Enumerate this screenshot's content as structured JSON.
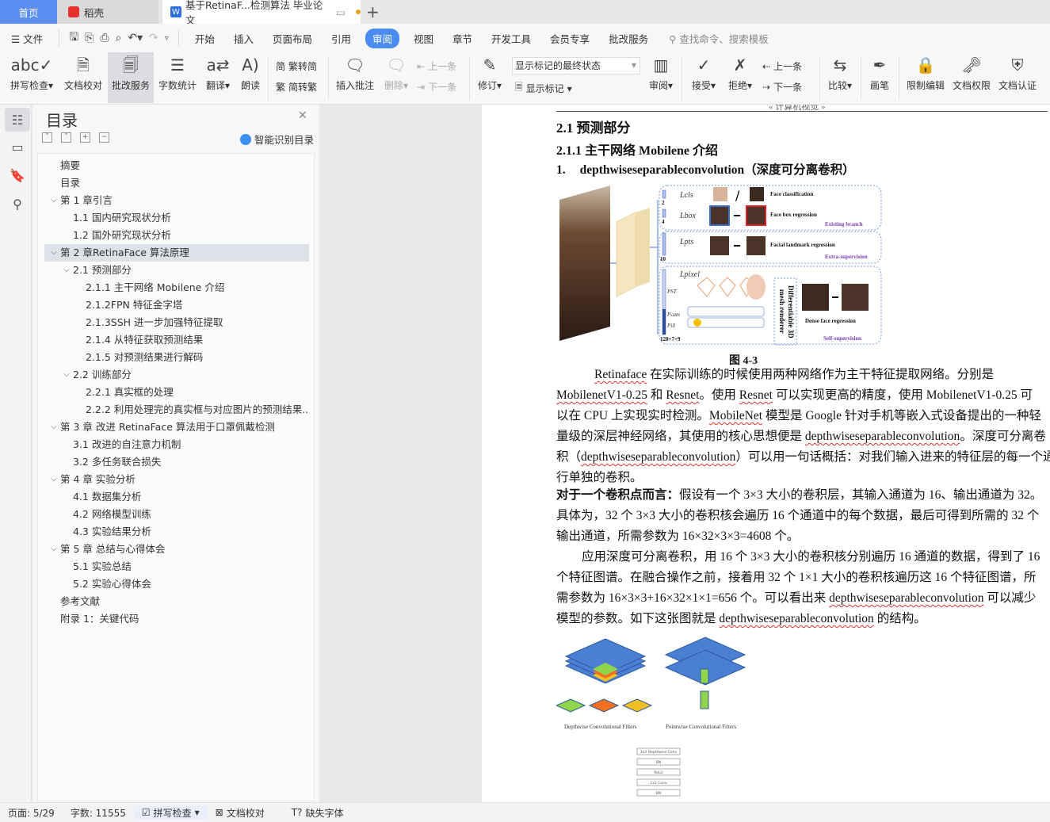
{
  "tabs": {
    "home": "首页",
    "docer": "稻壳",
    "doc": "基于RetinaF...检测算法 毕业论文",
    "add": "+"
  },
  "menu": {
    "file": "文件",
    "items": [
      "开始",
      "插入",
      "页面布局",
      "引用",
      "审阅",
      "视图",
      "章节",
      "开发工具",
      "会员专享",
      "批改服务"
    ],
    "active": "审阅",
    "search_placeholder": "查找命令、搜索模板"
  },
  "ribbon": {
    "spell": "拼写检查",
    "proof": "文档校对",
    "review_service": "批改服务",
    "wordcount": "字数统计",
    "translate": "翻译",
    "read": "朗读",
    "t2s": "繁转简",
    "s2t": "简转繁",
    "insert_comment": "插入批注",
    "delete": "删除",
    "prev_comment": "上一条",
    "next_comment": "下一条",
    "revise": "修订",
    "display_select": "显示标记的最终状态",
    "show_marks": "显示标记",
    "review": "审阅",
    "accept": "接受",
    "reject": "拒绝",
    "prev": "上一条",
    "next": "下一条",
    "compare": "比较",
    "pen": "画笔",
    "restrict": "限制编辑",
    "perm": "文档权限",
    "cert": "文档认证"
  },
  "toc": {
    "title": "目录",
    "smart": "智能识别目录",
    "items": [
      {
        "label": "摘要",
        "level": 0,
        "chev": false
      },
      {
        "label": "目录",
        "level": 0,
        "chev": false
      },
      {
        "label": "第 1 章引言",
        "level": 0,
        "chev": true
      },
      {
        "label": "1.1 国内研究现状分析",
        "level": 1,
        "chev": false
      },
      {
        "label": "1.2 国外研究现状分析",
        "level": 1,
        "chev": false
      },
      {
        "label": "第 2 章RetinaFace 算法原理",
        "level": 0,
        "chev": true,
        "selected": true
      },
      {
        "label": "2.1 预测部分",
        "level": 1,
        "chev": true
      },
      {
        "label": "2.1.1 主干网络 Mobilene 介绍",
        "level": 2,
        "chev": false
      },
      {
        "label": "2.1.2FPN 特征金字塔",
        "level": 2,
        "chev": false
      },
      {
        "label": "2.1.3SSH 进一步加强特征提取",
        "level": 2,
        "chev": false
      },
      {
        "label": "2.1.4 从特征获取预测结果",
        "level": 2,
        "chev": false
      },
      {
        "label": "2.1.5 对预测结果进行解码",
        "level": 2,
        "chev": false
      },
      {
        "label": "2.2 训练部分",
        "level": 1,
        "chev": true
      },
      {
        "label": "2.2.1 真实框的处理",
        "level": 2,
        "chev": false
      },
      {
        "label": "2.2.2 利用处理完的真实框与对应图片的预测结果...",
        "level": 2,
        "chev": false
      },
      {
        "label": "第 3 章 改进 RetinaFace 算法用于口罩佩戴检测",
        "level": 0,
        "chev": true
      },
      {
        "label": "3.1 改进的自注意力机制",
        "level": 1,
        "chev": false
      },
      {
        "label": "3.2 多任务联合损失",
        "level": 1,
        "chev": false
      },
      {
        "label": "第 4 章 实验分析",
        "level": 0,
        "chev": true
      },
      {
        "label": "4.1 数据集分析",
        "level": 1,
        "chev": false
      },
      {
        "label": "4.2 网络模型训练",
        "level": 1,
        "chev": false
      },
      {
        "label": "4.3 实验结果分析",
        "level": 1,
        "chev": false
      },
      {
        "label": "第 5 章 总结与心得体会",
        "level": 0,
        "chev": true
      },
      {
        "label": "5.1 实验总结",
        "level": 1,
        "chev": false
      },
      {
        "label": "5.2 实验心得体会",
        "level": 1,
        "chev": false
      },
      {
        "label": "参考文献",
        "level": 0,
        "chev": false
      },
      {
        "label": "附录 1：关键代码",
        "level": 0,
        "chev": false
      }
    ]
  },
  "doc": {
    "header": "« 计算机视觉 »",
    "h1": "2.1  预测部分",
    "h2": "2.1.1 主干网络 Mobilene 介绍",
    "h3_num": "1.",
    "h3": "depthwiseseparableconvolution（深度可分离卷积）",
    "fig1": {
      "caption": "图 4-3",
      "lcls": "Lcls",
      "lbox": "Lbox",
      "lpts": "Lpts",
      "lpixel": "Lpixel",
      "cls": "Face classification",
      "box": "Face box regression",
      "existing": "Existing branch",
      "landmark": "Facial landmark regression",
      "extra": "Extra-supervision",
      "dense": "Dense face regression",
      "self": "Self-supervision",
      "renderer": "Differentiable 3D mesh renderer",
      "n2": "2",
      "n4": "4",
      "n10": "10",
      "n128": "128+7+9",
      "pst": "PST",
      "pcam": "Pcam",
      "pill": "Pill"
    },
    "lines": [
      "<span class='sq'>Retinaface</span> 在实际训练的时候使用两种网络作为主干特征提取网络。分别是",
      "<span class='sq'>MobilenetV1-0.25</span> 和 <span class='sq'>Resnet</span>。使用 <span class='sq'>Resnet</span> 可以实现更高的精度，使用 MobilenetV1-0.25 可",
      "以在 CPU 上实现实时检测。<span class='sq'>MobileNet</span> 模型是 Google 针对手机等嵌入式设备提出的一种轻",
      "量级的深层神经网络，其使用的核心思想便是 <span class='sq'>depthwiseseparableconvolution</span>。深度可分离卷",
      "积（<span class='sq'>depthwiseseparableconvolution</span>）可以用一句话概括：对我们输入进来的特征层的每一个通道进",
      "行单独的卷积。",
      "<b>对于一个卷积点而言：</b>假设有一个 3×3 大小的卷积层，其输入通道为 16、输出通道为 32。",
      "具体为，32 个 3×3 大小的卷积核会遍历 16 个通道中的每个数据，最后可得到所需的 32 个",
      "输出通道，所需参数为 16×32×3×3=4608 个。",
      "        应用深度可分离卷积，用 16 个 3×3 大小的卷积核分别遍历 16 通道的数据，得到了 16",
      "个特征图谱。在融合操作之前，接着用 32 个 1×1 大小的卷积核遍历这 16 个特征图谱，所",
      "需参数为 16×3×3+16×32×1×1=656 个。可以看出来 <span class='sq'>depthwiseseparableconvolution</span> 可以减少",
      "模型的参数。如下这张图就是 <span class='sq'>depthwiseseparableconvolution</span> 的结构。"
    ],
    "fig2": {
      "dw": "Depthwise Convolutional Filters",
      "pw": "Pointwise Convolutional Filters",
      "flow": [
        "3x3 Depthwise Conv",
        "BN",
        "ReLU",
        "1x1 Conv",
        "BN"
      ]
    }
  },
  "status": {
    "page": "页面: 5/29",
    "words": "字数: 11555",
    "spell": "拼写检查",
    "proof": "文档校对",
    "font": "缺失字体"
  },
  "colors": {
    "accent": "#4a8cf0",
    "home_tab": "#5c8ef0",
    "toc_selected": "#dde1e8",
    "squiggle": "#d33333"
  }
}
